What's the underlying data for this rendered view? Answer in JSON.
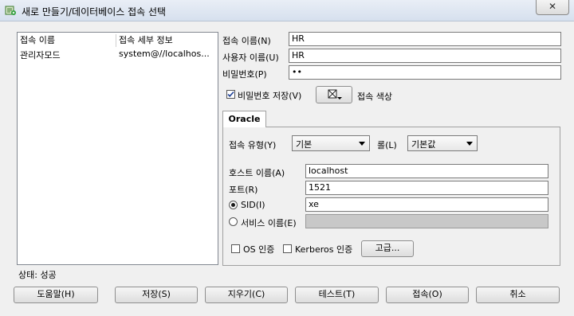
{
  "window": {
    "title": "새로 만들기/데이터베이스 접속 선택",
    "close_glyph": "✕"
  },
  "connections": {
    "headers": [
      "접속 이름",
      "접속 세부 정보"
    ],
    "rows": [
      {
        "name": "관리자모드",
        "details": "system@//localhos..."
      }
    ]
  },
  "form": {
    "conn_name_label": "접속 이름(N)",
    "conn_name": "HR",
    "user_label": "사용자 이름(U)",
    "user": "HR",
    "password_label": "비밀번호(P)",
    "password": "••",
    "save_password_label": "비밀번호 저장(V)",
    "save_password_checked": true,
    "conn_color_label": "접속 색상"
  },
  "tab": {
    "label": "Oracle"
  },
  "oracle": {
    "conn_type_label": "접속 유형(Y)",
    "conn_type": "기본",
    "role_label": "롤(L)",
    "role": "기본값",
    "host_label": "호스트 이름(A)",
    "host": "localhost",
    "port_label": "포트(R)",
    "port": "1521",
    "sid_label": "SID(I)",
    "sid": "xe",
    "service_label": "서비스 이름(E)",
    "service": "",
    "os_auth_label": "OS 인증",
    "kerberos_label": "Kerberos 인증",
    "advanced_label": "고급..."
  },
  "status": {
    "text": "상태: 성공"
  },
  "buttons": {
    "help": "도움말(H)",
    "save": "저장(S)",
    "clear": "지우기(C)",
    "test": "테스트(T)",
    "connect": "접속(O)",
    "cancel": "취소"
  }
}
